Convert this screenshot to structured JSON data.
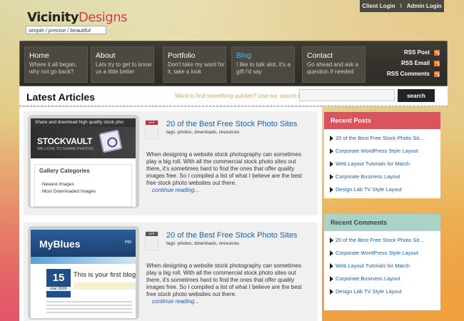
{
  "header": {
    "logo_vicinity": "Vicinity",
    "logo_designs": "Designs",
    "tagline": "simple / precise / beautiful",
    "client_login": "Client Login",
    "separator": "\\",
    "admin_login": "Admin Login"
  },
  "nav": [
    {
      "title": "Home",
      "desc": "Where it all began, why not go back?"
    },
    {
      "title": "About",
      "desc": "Lets try to get to know us a little better"
    },
    {
      "title": "Portfolio",
      "desc": "Don't take my word for it, take a look"
    },
    {
      "title": "Blog",
      "desc": "I like to talk alot, it's a gift I'd say",
      "active": true
    },
    {
      "title": "Contact",
      "desc": "Go ahead and ask a question if needed"
    }
  ],
  "rss": {
    "post": "RSS Post",
    "email": "RSS Email",
    "comments": "RSS Comments"
  },
  "latest": {
    "title": "Latest Articles",
    "search_hint": "Want to find something quicker?  Use our search bar",
    "search_button": "search"
  },
  "articles": [
    {
      "month": "APR",
      "title": "20 of the Best Free Stock Photo Sites",
      "tags": "tags: photos, downloads, resources",
      "body": "When designing a website stock photography can sometimes play a big roll. With all the commercial stock photo sites out there, it's sometimes hard to find the ones that offer quality images free. So I compiled a list of what I believe are the best free stock photo websites out there.",
      "continue": "continue reading...",
      "thumb": {
        "topline": "Share and download high quality stock pho",
        "logo": "STOCKVAULT",
        "sub": "WE LOVE TO SHARE PHOTOS",
        "cats_title": "Gallery Categories",
        "cats": [
          "Newest Images",
          "Most Downloaded Images"
        ]
      }
    },
    {
      "month": "APR",
      "title": "20 of the Best Free Stock Photo Sites",
      "tags": "tags: photos, downloads, resources",
      "body": "When designing a website stock photography can sometimes play a big roll. With all the commercial stock photo sites out there, it's sometimes hard to find the ones that offer quality images free. So I compiled a list of what I believe are the best free stock photo websites out there.",
      "continue": "continue reading...",
      "thumb": {
        "logo": "MyBlues",
        "home": "Ho",
        "day": "15",
        "monthyear": "mar 2009",
        "first": "This is your first blog"
      }
    }
  ],
  "sidebar": {
    "recent_posts": {
      "title": "Recent Posts",
      "items": [
        "20 of the Best Free Stock Photo Sit...",
        "Corporate WordPress Style Layout",
        "Web Layout Tutorials for March",
        "Corporate Business Layout",
        "Design Lab TV Style Layout"
      ]
    },
    "recent_comments": {
      "title": "Recent Comments",
      "items": [
        "20 of the Best Free Stock Photo Sit...",
        "Corporate WordPress Style Layout",
        "Web Layout Tutorials for March",
        "Corporate Business Layout",
        "Design Lab TV Style Layout"
      ]
    }
  },
  "colors": {
    "accent_red": "#d9545f",
    "accent_teal": "#a9d3c9",
    "link_blue": "#1f5ea8",
    "nav_active": "#56b5e6",
    "rss_orange": "#f07a25"
  }
}
